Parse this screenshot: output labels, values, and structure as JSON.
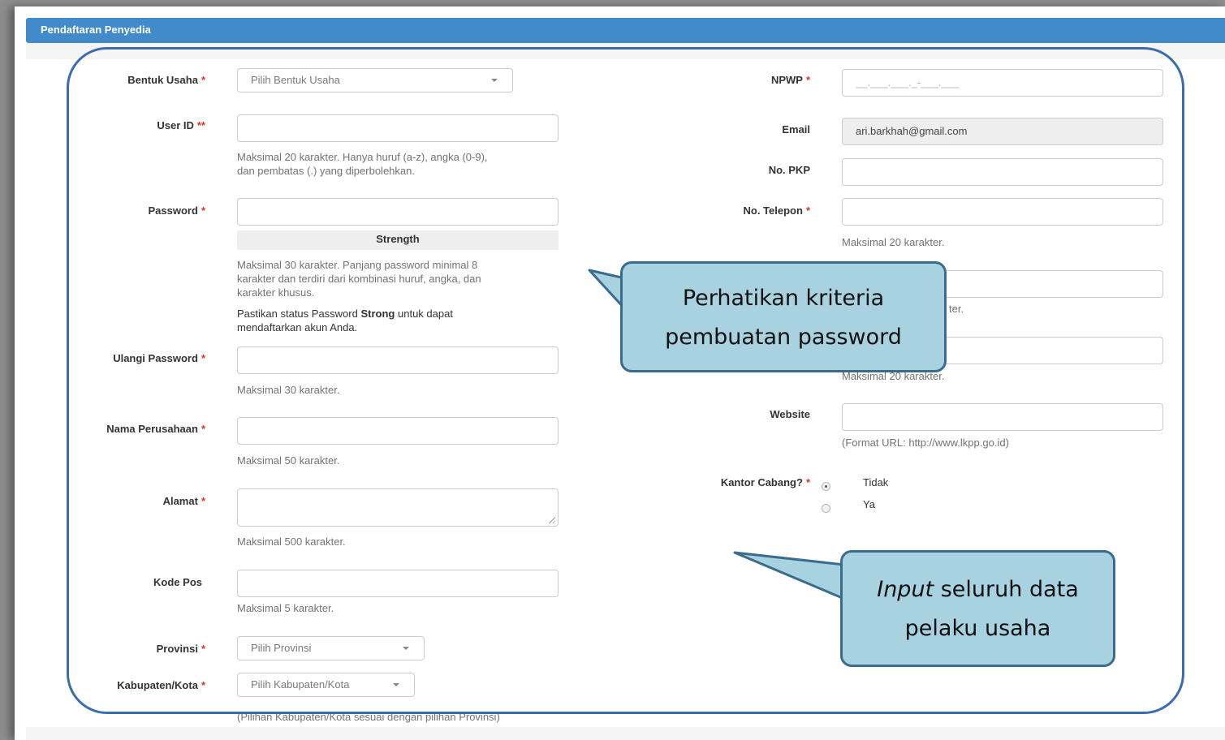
{
  "header": {
    "title": "Pendaftaran Penyedia"
  },
  "left": {
    "bentuk_usaha": {
      "label": "Bentuk Usaha",
      "required": "*",
      "placeholder": "Pilih Bentuk Usaha"
    },
    "user_id": {
      "label": "User ID",
      "required": "**",
      "value": "",
      "help_line1": "Maksimal 20 karakter. Hanya huruf (a-z), angka (0-9),",
      "help_line2": "dan pembatas (.) yang diperbolehkan."
    },
    "password": {
      "label": "Password",
      "required": "*",
      "value": "",
      "strength_label": "Strength",
      "help_line1": "Maksimal 30 karakter. Panjang password minimal 8",
      "help_line2": "karakter dan terdiri dari kombinasi huruf, angka, dan",
      "help_line3": "karakter khusus.",
      "note_prefix": "Pastikan status Password",
      "note_bold": "Strong",
      "note_suffix": "untuk dapat",
      "note_line2": "mendaftarkan akun Anda."
    },
    "ulangi_password": {
      "label": "Ulangi Password",
      "required": "*",
      "value": "",
      "help": "Maksimal 30 karakter."
    },
    "nama_perusahaan": {
      "label": "Nama Perusahaan",
      "required": "*",
      "value": "",
      "help": "Maksimal 50 karakter."
    },
    "alamat": {
      "label": "Alamat",
      "required": "*",
      "value": "",
      "help": "Maksimal 500 karakter."
    },
    "kode_pos": {
      "label": "Kode Pos",
      "required": "",
      "value": "",
      "help": "Maksimal 5 karakter."
    },
    "provinsi": {
      "label": "Provinsi",
      "required": "*",
      "placeholder": "Pilih Provinsi"
    },
    "kabupaten": {
      "label": "Kabupaten/Kota",
      "required": "*",
      "placeholder": "Pilih Kabupaten/Kota",
      "help": "(Pilihan Kabupaten/Kota sesuai dengan pilihan Provinsi)"
    }
  },
  "right": {
    "npwp": {
      "label": "NPWP",
      "required": "*",
      "placeholder": "__.___.___._-___.___"
    },
    "email": {
      "label": "Email",
      "value": "ari.barkhah@gmail.com"
    },
    "no_pkp": {
      "label": "No. PKP",
      "value": ""
    },
    "no_telepon": {
      "label": "No. Telepon",
      "required": "*",
      "value": "",
      "help": "Maksimal 20 karakter."
    },
    "field5": {
      "value": "",
      "help_visible": "ter."
    },
    "field6": {
      "value": "",
      "help": "Maksimal 20 karakter."
    },
    "website": {
      "label": "Website",
      "value": "",
      "help": "(Format URL: http://www.lkpp.go.id)"
    },
    "kantor_cabang": {
      "label": "Kantor Cabang?",
      "required": "*",
      "options": [
        "Tidak",
        "Ya"
      ],
      "selected": "Tidak"
    }
  },
  "callouts": {
    "password_tip": {
      "line1": "Perhatikan kriteria",
      "line2": "pembuatan password"
    },
    "input_tip": {
      "line1_italic": "Input",
      "line1_rest": " seluruh data",
      "line2": "pelaku usaha"
    }
  },
  "colors": {
    "header_bg": "#428bca",
    "required_star": "#d9342b",
    "highlight_border": "#3b6cb0",
    "callout_fill": "#a9d2e1",
    "callout_border": "#3a6c8e"
  }
}
